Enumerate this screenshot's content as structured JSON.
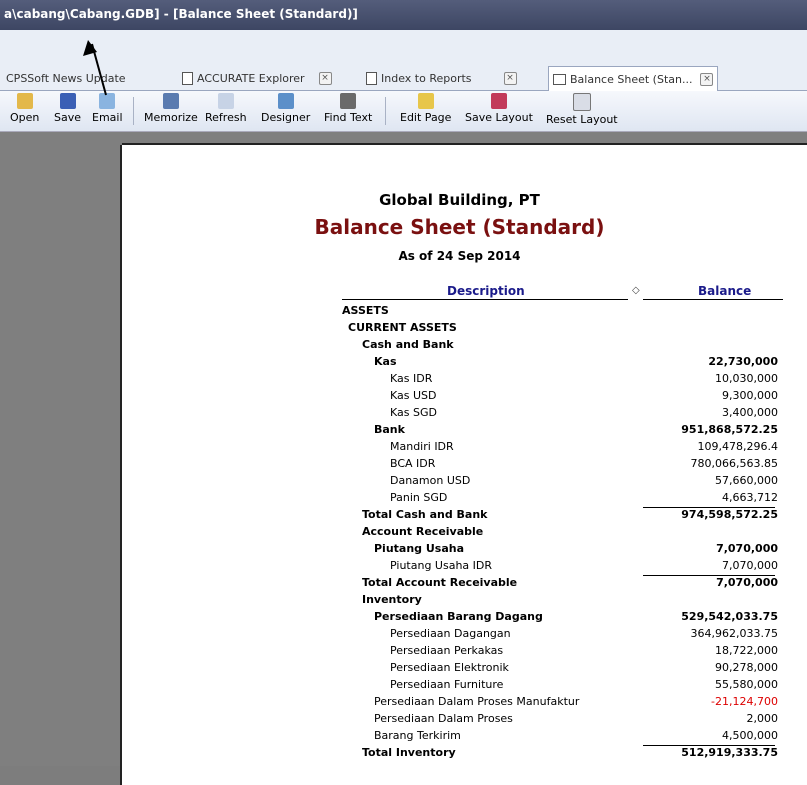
{
  "window": {
    "title": "a\\cabang\\Cabang.GDB] - [Balance Sheet (Standard)]"
  },
  "tabs": [
    {
      "label": "CPSSoft News Update",
      "close": false
    },
    {
      "label": "ACCURATE Explorer",
      "close": true
    },
    {
      "label": "Index to Reports",
      "close": true
    },
    {
      "label": "Balance Sheet (Stan...",
      "close": true,
      "active": true
    }
  ],
  "toolbar": {
    "open": "Open",
    "save": "Save",
    "email": "Email",
    "memorize": "Memorize",
    "refresh": "Refresh",
    "designer": "Designer",
    "find_text": "Find Text",
    "edit_page": "Edit Page",
    "save_layout": "Save Layout",
    "reset_layout": "Reset Layout"
  },
  "report": {
    "company": "Global Building, PT",
    "title": "Balance Sheet (Standard)",
    "as_of": "As of 24 Sep 2014",
    "col_description": "Description",
    "col_balance": "Balance",
    "col_marker": "◇",
    "rows": [
      {
        "label": "ASSETS",
        "value": "",
        "indent": 0,
        "bold": true
      },
      {
        "label": "CURRENT ASSETS",
        "value": "",
        "indent": 1,
        "bold": true
      },
      {
        "label": "Cash and Bank",
        "value": "",
        "indent": 2,
        "bold": true
      },
      {
        "label": "Kas",
        "value": "22,730,000",
        "indent": 3,
        "bold": true
      },
      {
        "label": "Kas IDR",
        "value": "10,030,000",
        "indent": 4,
        "bold": false
      },
      {
        "label": "Kas USD",
        "value": "9,300,000",
        "indent": 4,
        "bold": false
      },
      {
        "label": "Kas SGD",
        "value": "3,400,000",
        "indent": 4,
        "bold": false
      },
      {
        "label": "Bank",
        "value": "951,868,572.25",
        "indent": 3,
        "bold": true
      },
      {
        "label": "Mandiri IDR",
        "value": "109,478,296.4",
        "indent": 4,
        "bold": false
      },
      {
        "label": "BCA IDR",
        "value": "780,066,563.85",
        "indent": 4,
        "bold": false
      },
      {
        "label": "Danamon USD",
        "value": "57,660,000",
        "indent": 4,
        "bold": false
      },
      {
        "label": "Panin SGD",
        "value": "4,663,712",
        "indent": 4,
        "bold": false
      },
      {
        "label": "Total Cash and Bank",
        "value": "974,598,572.25",
        "indent": 2,
        "bold": true,
        "topline": true
      },
      {
        "label": "Account Receivable",
        "value": "",
        "indent": 2,
        "bold": true
      },
      {
        "label": "Piutang Usaha",
        "value": "7,070,000",
        "indent": 3,
        "bold": true
      },
      {
        "label": "Piutang Usaha IDR",
        "value": "7,070,000",
        "indent": 4,
        "bold": false
      },
      {
        "label": "Total Account Receivable",
        "value": "7,070,000",
        "indent": 2,
        "bold": true,
        "topline": true
      },
      {
        "label": "Inventory",
        "value": "",
        "indent": 2,
        "bold": true
      },
      {
        "label": "Persediaan Barang Dagang",
        "value": "529,542,033.75",
        "indent": 3,
        "bold": true
      },
      {
        "label": "Persediaan Dagangan",
        "value": "364,962,033.75",
        "indent": 4,
        "bold": false
      },
      {
        "label": "Persediaan Perkakas",
        "value": "18,722,000",
        "indent": 4,
        "bold": false
      },
      {
        "label": "Persediaan Elektronik",
        "value": "90,278,000",
        "indent": 4,
        "bold": false
      },
      {
        "label": "Persediaan Furniture",
        "value": "55,580,000",
        "indent": 4,
        "bold": false
      },
      {
        "label": "Persediaan Dalam Proses Manufaktur",
        "value": "-21,124,700",
        "indent": 3,
        "bold": false,
        "negative": true
      },
      {
        "label": "Persediaan Dalam Proses",
        "value": "2,000",
        "indent": 3,
        "bold": false
      },
      {
        "label": "Barang Terkirim",
        "value": "4,500,000",
        "indent": 3,
        "bold": false
      },
      {
        "label": "Total Inventory",
        "value": "512,919,333.75",
        "indent": 2,
        "bold": true,
        "topline": true
      }
    ]
  }
}
